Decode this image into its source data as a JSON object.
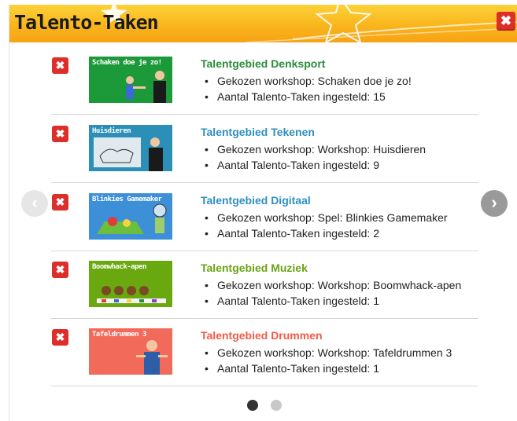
{
  "header": {
    "title": "Talento-Taken",
    "close_label": "✖",
    "colors": {
      "accent": "#f9b51c",
      "close": "#dd2f2a"
    }
  },
  "carousel": {
    "prev_icon": "chevron-left-icon",
    "next_icon": "chevron-right-icon",
    "prev_label": "‹",
    "next_label": "›",
    "pager": {
      "pages": 2,
      "active": 1
    }
  },
  "rows": [
    {
      "delete_label": "✖",
      "thumb_label": "Schaken doe je zo!",
      "thumb_color": "#1c9a3a",
      "title": "Talentgebied Denksport",
      "title_color": "#2a8d3a",
      "workshop": "Gekozen workshop: Schaken doe je zo!",
      "count": "Aantal Talento-Taken ingesteld: 15"
    },
    {
      "delete_label": "✖",
      "thumb_label": "Huisdieren",
      "thumb_color": "#2c8fb8",
      "title": "Talentgebied Tekenen",
      "title_color": "#2f8fc0",
      "workshop": "Gekozen workshop: Workshop: Huisdieren",
      "count": "Aantal Talento-Taken ingesteld: 9"
    },
    {
      "delete_label": "✖",
      "thumb_label": "Blinkies Gamemaker",
      "thumb_color": "#3d8fd8",
      "title": "Talentgebied Digitaal",
      "title_color": "#2f8fc0",
      "workshop": "Gekozen workshop: Spel: Blinkies Gamemaker",
      "count": "Aantal Talento-Taken ingesteld: 2"
    },
    {
      "delete_label": "✖",
      "thumb_label": "Boomwhack-apen",
      "thumb_color": "#6aa80f",
      "title": "Talentgebied Muziek",
      "title_color": "#6aa314",
      "workshop": "Gekozen workshop: Workshop: Boomwhack-apen",
      "count": "Aantal Talento-Taken ingesteld: 1"
    },
    {
      "delete_label": "✖",
      "thumb_label": "Tafeldrummen 3",
      "thumb_color": "#f26a5a",
      "title": "Talentgebied Drummen",
      "title_color": "#f25b47",
      "workshop": "Gekozen workshop: Workshop: Tafeldrummen 3",
      "count": "Aantal Talento-Taken ingesteld: 1"
    }
  ]
}
